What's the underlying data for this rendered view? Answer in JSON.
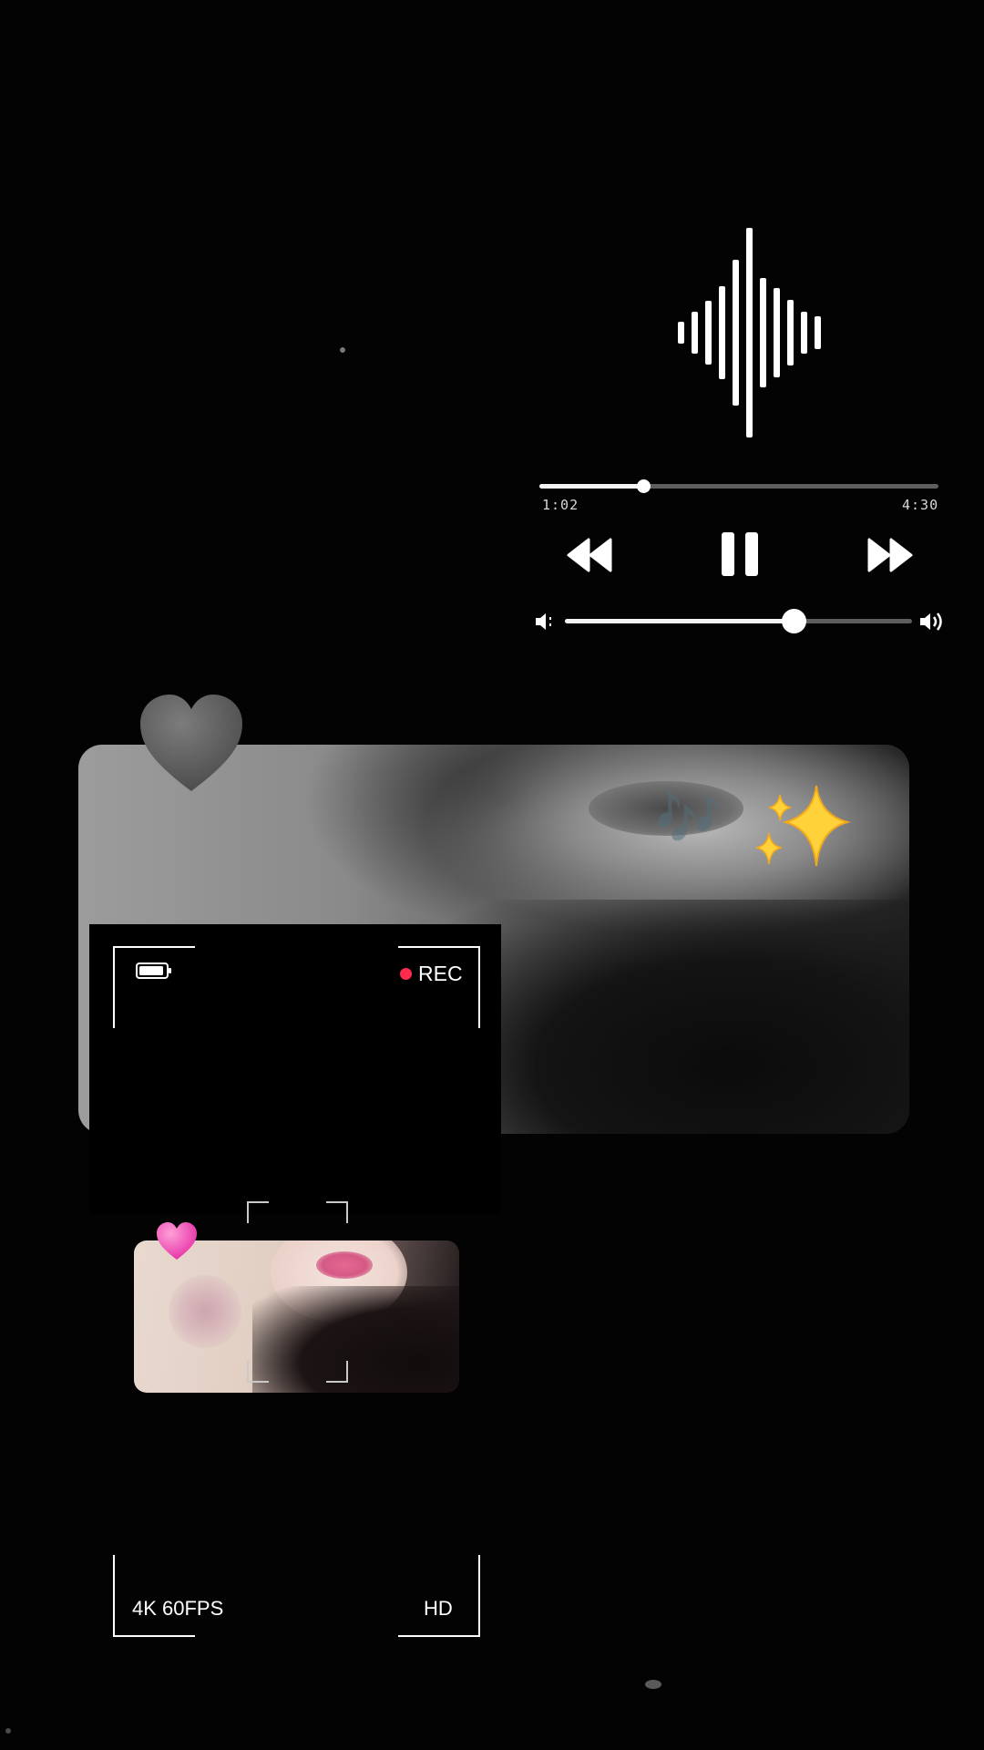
{
  "player": {
    "elapsed": "1:02",
    "total": "4:30",
    "progress_fraction": 0.26,
    "volume_fraction": 0.66,
    "is_playing": true
  },
  "camera": {
    "recording_label": "REC",
    "quality_left": "4K 60FPS",
    "quality_right": "HD",
    "rec_color": "#ff2a4d"
  },
  "icons": {
    "waveform": "sound-waveform-icon",
    "rewind": "rewind-icon",
    "pause": "pause-icon",
    "forward": "fast-forward-icon",
    "volume_low": "volume-low-icon",
    "volume_high": "volume-high-icon",
    "heart_grey": "grey-heart-emoji",
    "heart_pink": "pink-heart-emoji",
    "sparkles": "sparkles-emoji",
    "music_notes": "music-notes-emoji",
    "battery": "battery-icon"
  },
  "music_notes_glyph": "🎶"
}
